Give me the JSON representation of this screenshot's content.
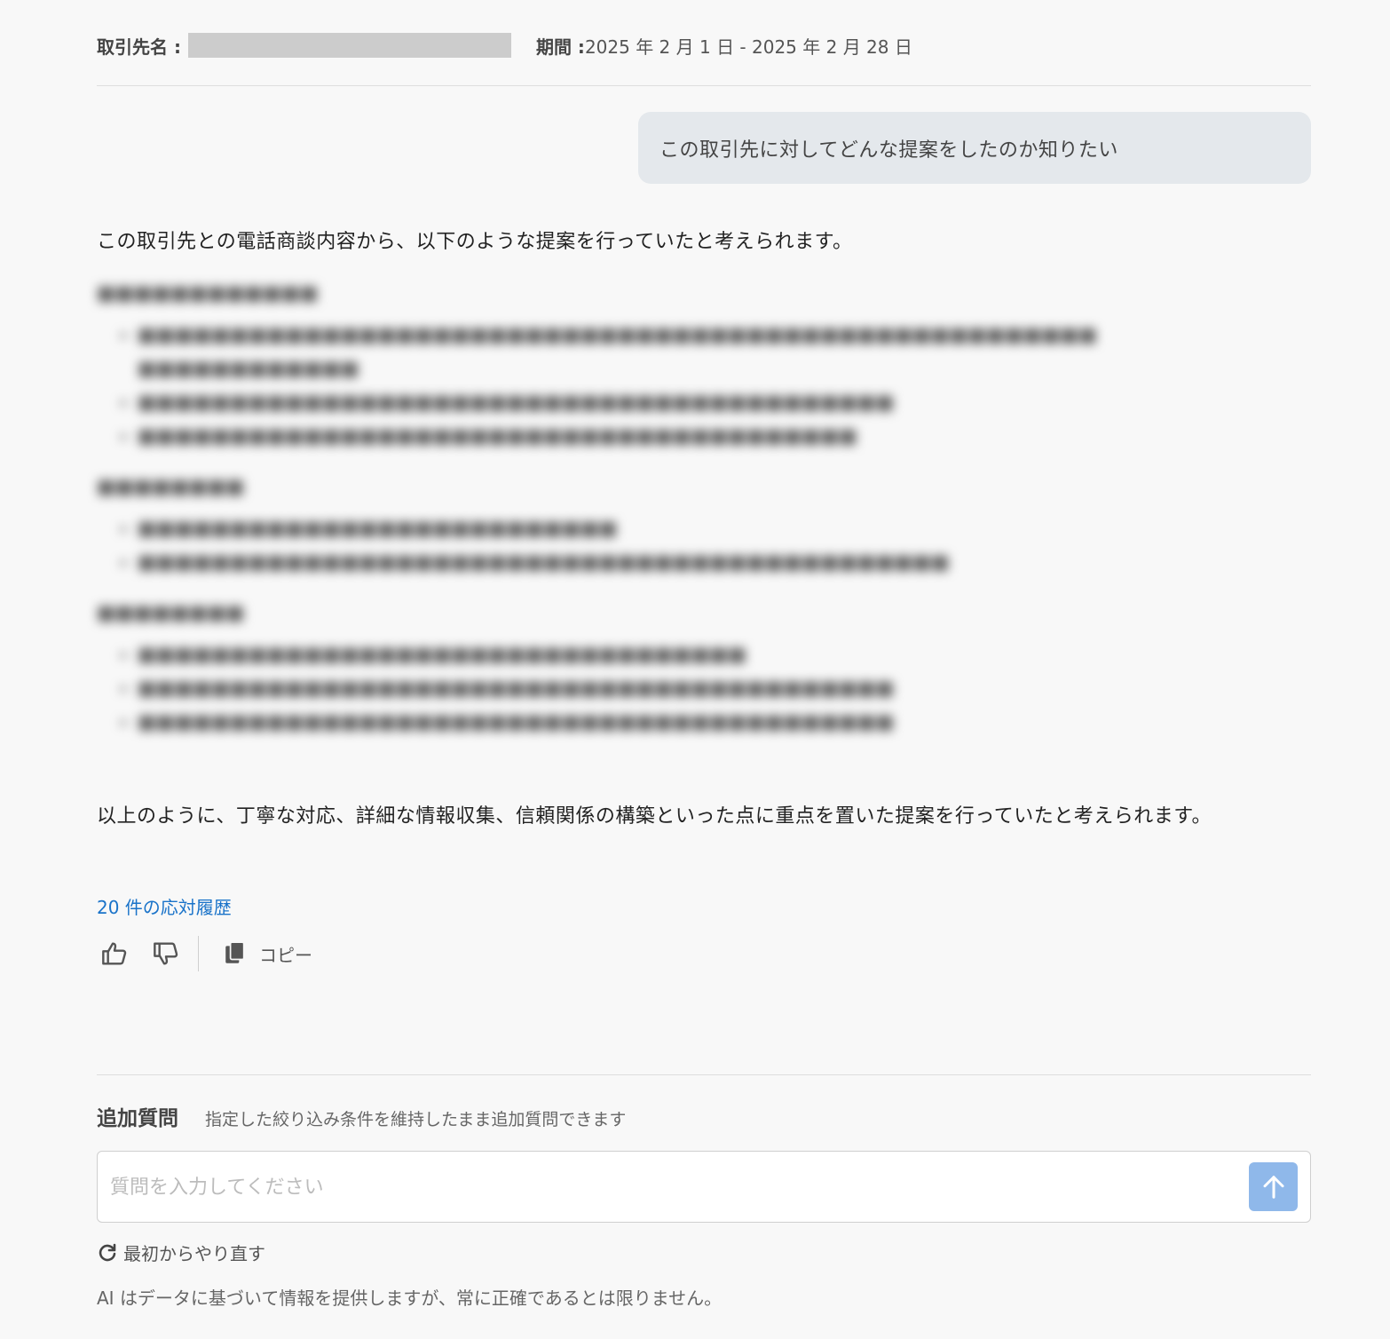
{
  "header": {
    "client_label": "取引先名 :",
    "period_label": "期間 :",
    "period_value": "2025 年 2 月 1 日 - 2025 年 2 月 28 日"
  },
  "chat": {
    "user_message": "この取引先に対してどんな提案をしたのか知りたい",
    "answer_intro": "この取引先との電話商談内容から、以下のような提案を行っていたと考えられます。",
    "answer_conclusion": "以上のように、丁寧な対応、詳細な情報収集、信頼関係の構築といった点に重点を置いた提案を行っていたと考えられます。",
    "history_link": "20 件の応対履歴",
    "copy_label": "コピー"
  },
  "followup": {
    "title": "追加質問",
    "subtitle": "指定した絞り込み条件を維持したまま追加質問できます",
    "input_placeholder": "質問を入力してください",
    "input_value": "",
    "restart_label": "最初からやり直す",
    "disclaimer": "AI はデータに基づいて情報を提供しますが、常に正確であるとは限りません。"
  },
  "colors": {
    "link": "#1a73c9",
    "send_button": "#8fb8ea",
    "bubble_bg": "#e4e8ec",
    "masked": "#cccccc"
  },
  "icons": [
    "thumbs-up-icon",
    "thumbs-down-icon",
    "copy-icon",
    "arrow-up-icon",
    "refresh-icon"
  ]
}
